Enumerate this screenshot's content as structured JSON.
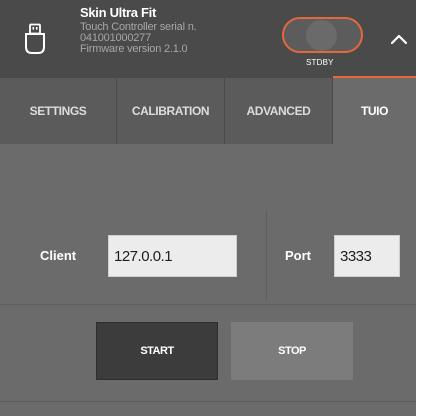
{
  "device": {
    "name": "Skin Ultra Fit",
    "model": "Touch Controller serial n.",
    "serial": "041001000277",
    "firmware": "Firmware version 2.1.0",
    "icon": "usb-icon"
  },
  "power_toggle": {
    "label": "STDBY",
    "state": "standby"
  },
  "collapse_icon": "chevron-up-icon",
  "tabs": [
    {
      "label": "SETTINGS",
      "active": false
    },
    {
      "label": "CALIBRATION",
      "active": false
    },
    {
      "label": "ADVANCED",
      "active": false
    },
    {
      "label": "TUIO",
      "active": true
    }
  ],
  "tuio": {
    "client_label": "Client",
    "client_value": "127.0.0.1",
    "port_label": "Port",
    "port_value": "3333",
    "start_label": "START",
    "stop_label": "STOP"
  },
  "colors": {
    "accent": "#e4683c",
    "header_bg": "#4a4a4a",
    "panel_bg": "#6b6b6b",
    "tab_bg": "#5b5b5b",
    "start_bg": "#3c3c3c",
    "stop_bg": "#7c7c7c"
  }
}
